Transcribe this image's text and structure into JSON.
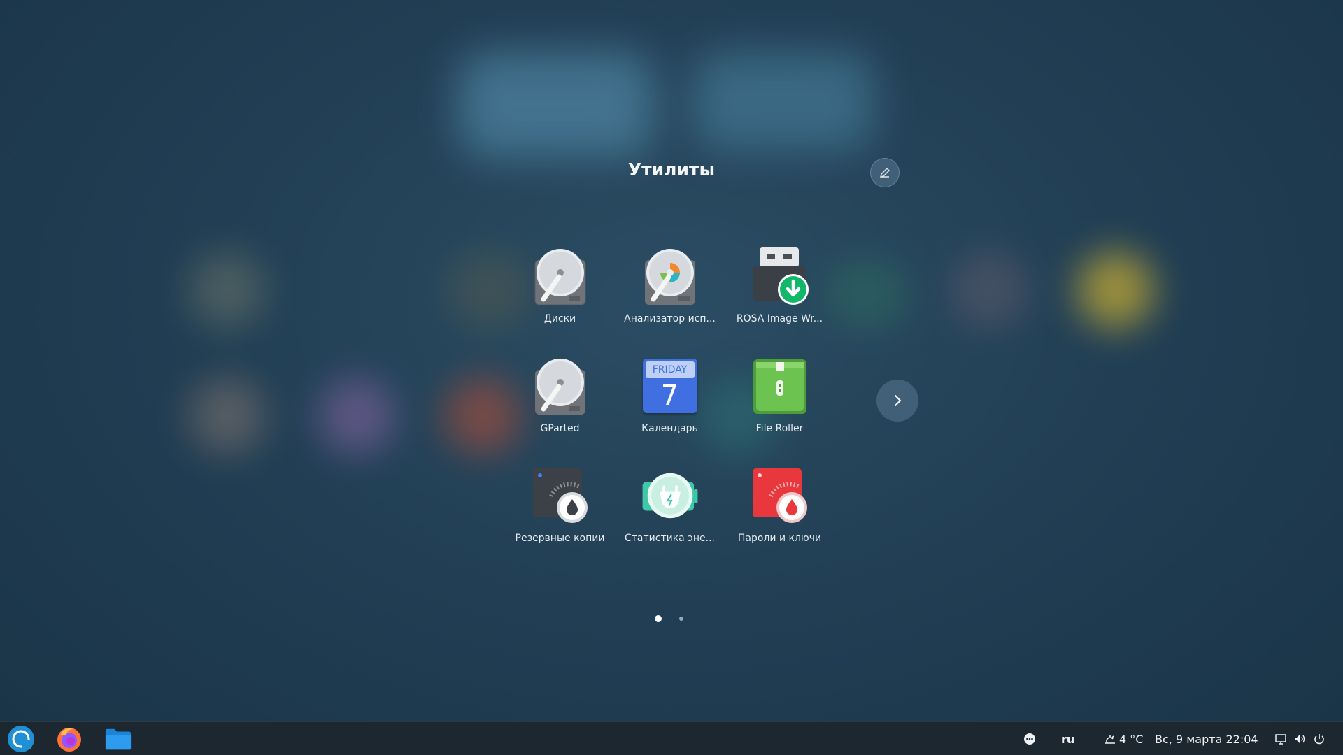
{
  "folder": {
    "title": "Утилиты",
    "apps": [
      {
        "label": "Диски",
        "icon": "disks-icon"
      },
      {
        "label": "Анализатор исп...",
        "icon": "disk-usage-analyzer-icon"
      },
      {
        "label": "ROSA Image Wr...",
        "icon": "rosa-image-writer-icon"
      },
      {
        "label": "GParted",
        "icon": "gparted-icon"
      },
      {
        "label": "Календарь",
        "icon": "calendar-icon"
      },
      {
        "label": "File Roller",
        "icon": "file-roller-icon"
      },
      {
        "label": "Резервные копии",
        "icon": "backups-icon"
      },
      {
        "label": "Статистика эне...",
        "icon": "power-statistics-icon"
      },
      {
        "label": "Пароли и ключи",
        "icon": "passwords-keys-icon"
      }
    ],
    "calendar_day": "FRIDAY",
    "calendar_date": "7",
    "pages": 2,
    "current_page": 1
  },
  "taskbar": {
    "language": "ru",
    "weather": "4 °C",
    "datetime": "Вс, 9 марта  22:04"
  },
  "colors": {
    "taskbar_bg": "#1c2730",
    "calendar_blue": "#3f6fe0",
    "archive_green": "#6cc34f",
    "backup_red": "#e8383d",
    "usb_green": "#12b76a"
  }
}
